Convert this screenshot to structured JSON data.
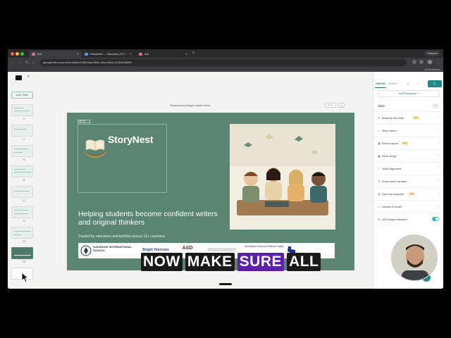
{
  "browser": {
    "tabs": [
      {
        "label": "Aai",
        "active": true
      },
      {
        "label": "StoryNest — Discovery & P…",
        "active": false
      },
      {
        "label": "Aai",
        "active": false
      }
    ],
    "relaunch_label": "Relaunch",
    "url": "app.getalai.com/presentation/03463eaa-563c-4ecc-864c-31d0db38db9",
    "all_bookmarks": "All Bookmarks"
  },
  "sidebar": {
    "add_slide_label": "Add Slide",
    "thumb_numbers": [
      "8",
      "9",
      "10",
      "11",
      "12",
      "13",
      "14",
      "15"
    ]
  },
  "canvas": {
    "deck_name": "Storynest prototype master deck",
    "slide": {
      "badge": "Slide 15",
      "brand_name": "StoryNest",
      "headline": "Helping students become confident writers and original thinkers",
      "trusted_text": "Trusted by educators and families across 12+ countries:",
      "partners": [
        "OAKRIDGE INTERNATIONAL SCHOOL",
        "Bright Horizons",
        "ASD",
        "Montessori School of Silicon Valley"
      ]
    }
  },
  "panel": {
    "tabs": [
      "DESIGN",
      "AGENT"
    ],
    "add_elements_label": "Add Elements",
    "section_title": "Slide",
    "rows": [
      {
        "label": "Beautify this slide",
        "icon": "sparkle-icon",
        "new": true
      },
      {
        "label": "Slide colors",
        "icon": "palette-icon",
        "new": false
      },
      {
        "label": "Remix layout",
        "icon": "layout-icon",
        "new": true
      },
      {
        "label": "Slide image",
        "icon": "image-icon",
        "new": false
      },
      {
        "label": "Slide alignment",
        "icon": "align-icon",
        "new": false
      },
      {
        "label": "Show older variants",
        "icon": "history-icon",
        "new": false
      },
      {
        "label": "Save as template",
        "icon": "template-icon",
        "new": true
      },
      {
        "label": "Header & footer",
        "icon": "header-icon",
        "new": false
      },
      {
        "label": "16:9 height indicator",
        "icon": "ratio-icon",
        "new": false,
        "toggle": true
      }
    ],
    "new_badge": "New"
  },
  "caption": {
    "words": [
      "NOW",
      "MAKE",
      "SURE",
      "ALL"
    ],
    "highlighted_index": 2
  },
  "colors": {
    "slide_bg": "#5a8573",
    "accent": "#1c8b8a",
    "caption_highlight": "#5b1fa8"
  }
}
